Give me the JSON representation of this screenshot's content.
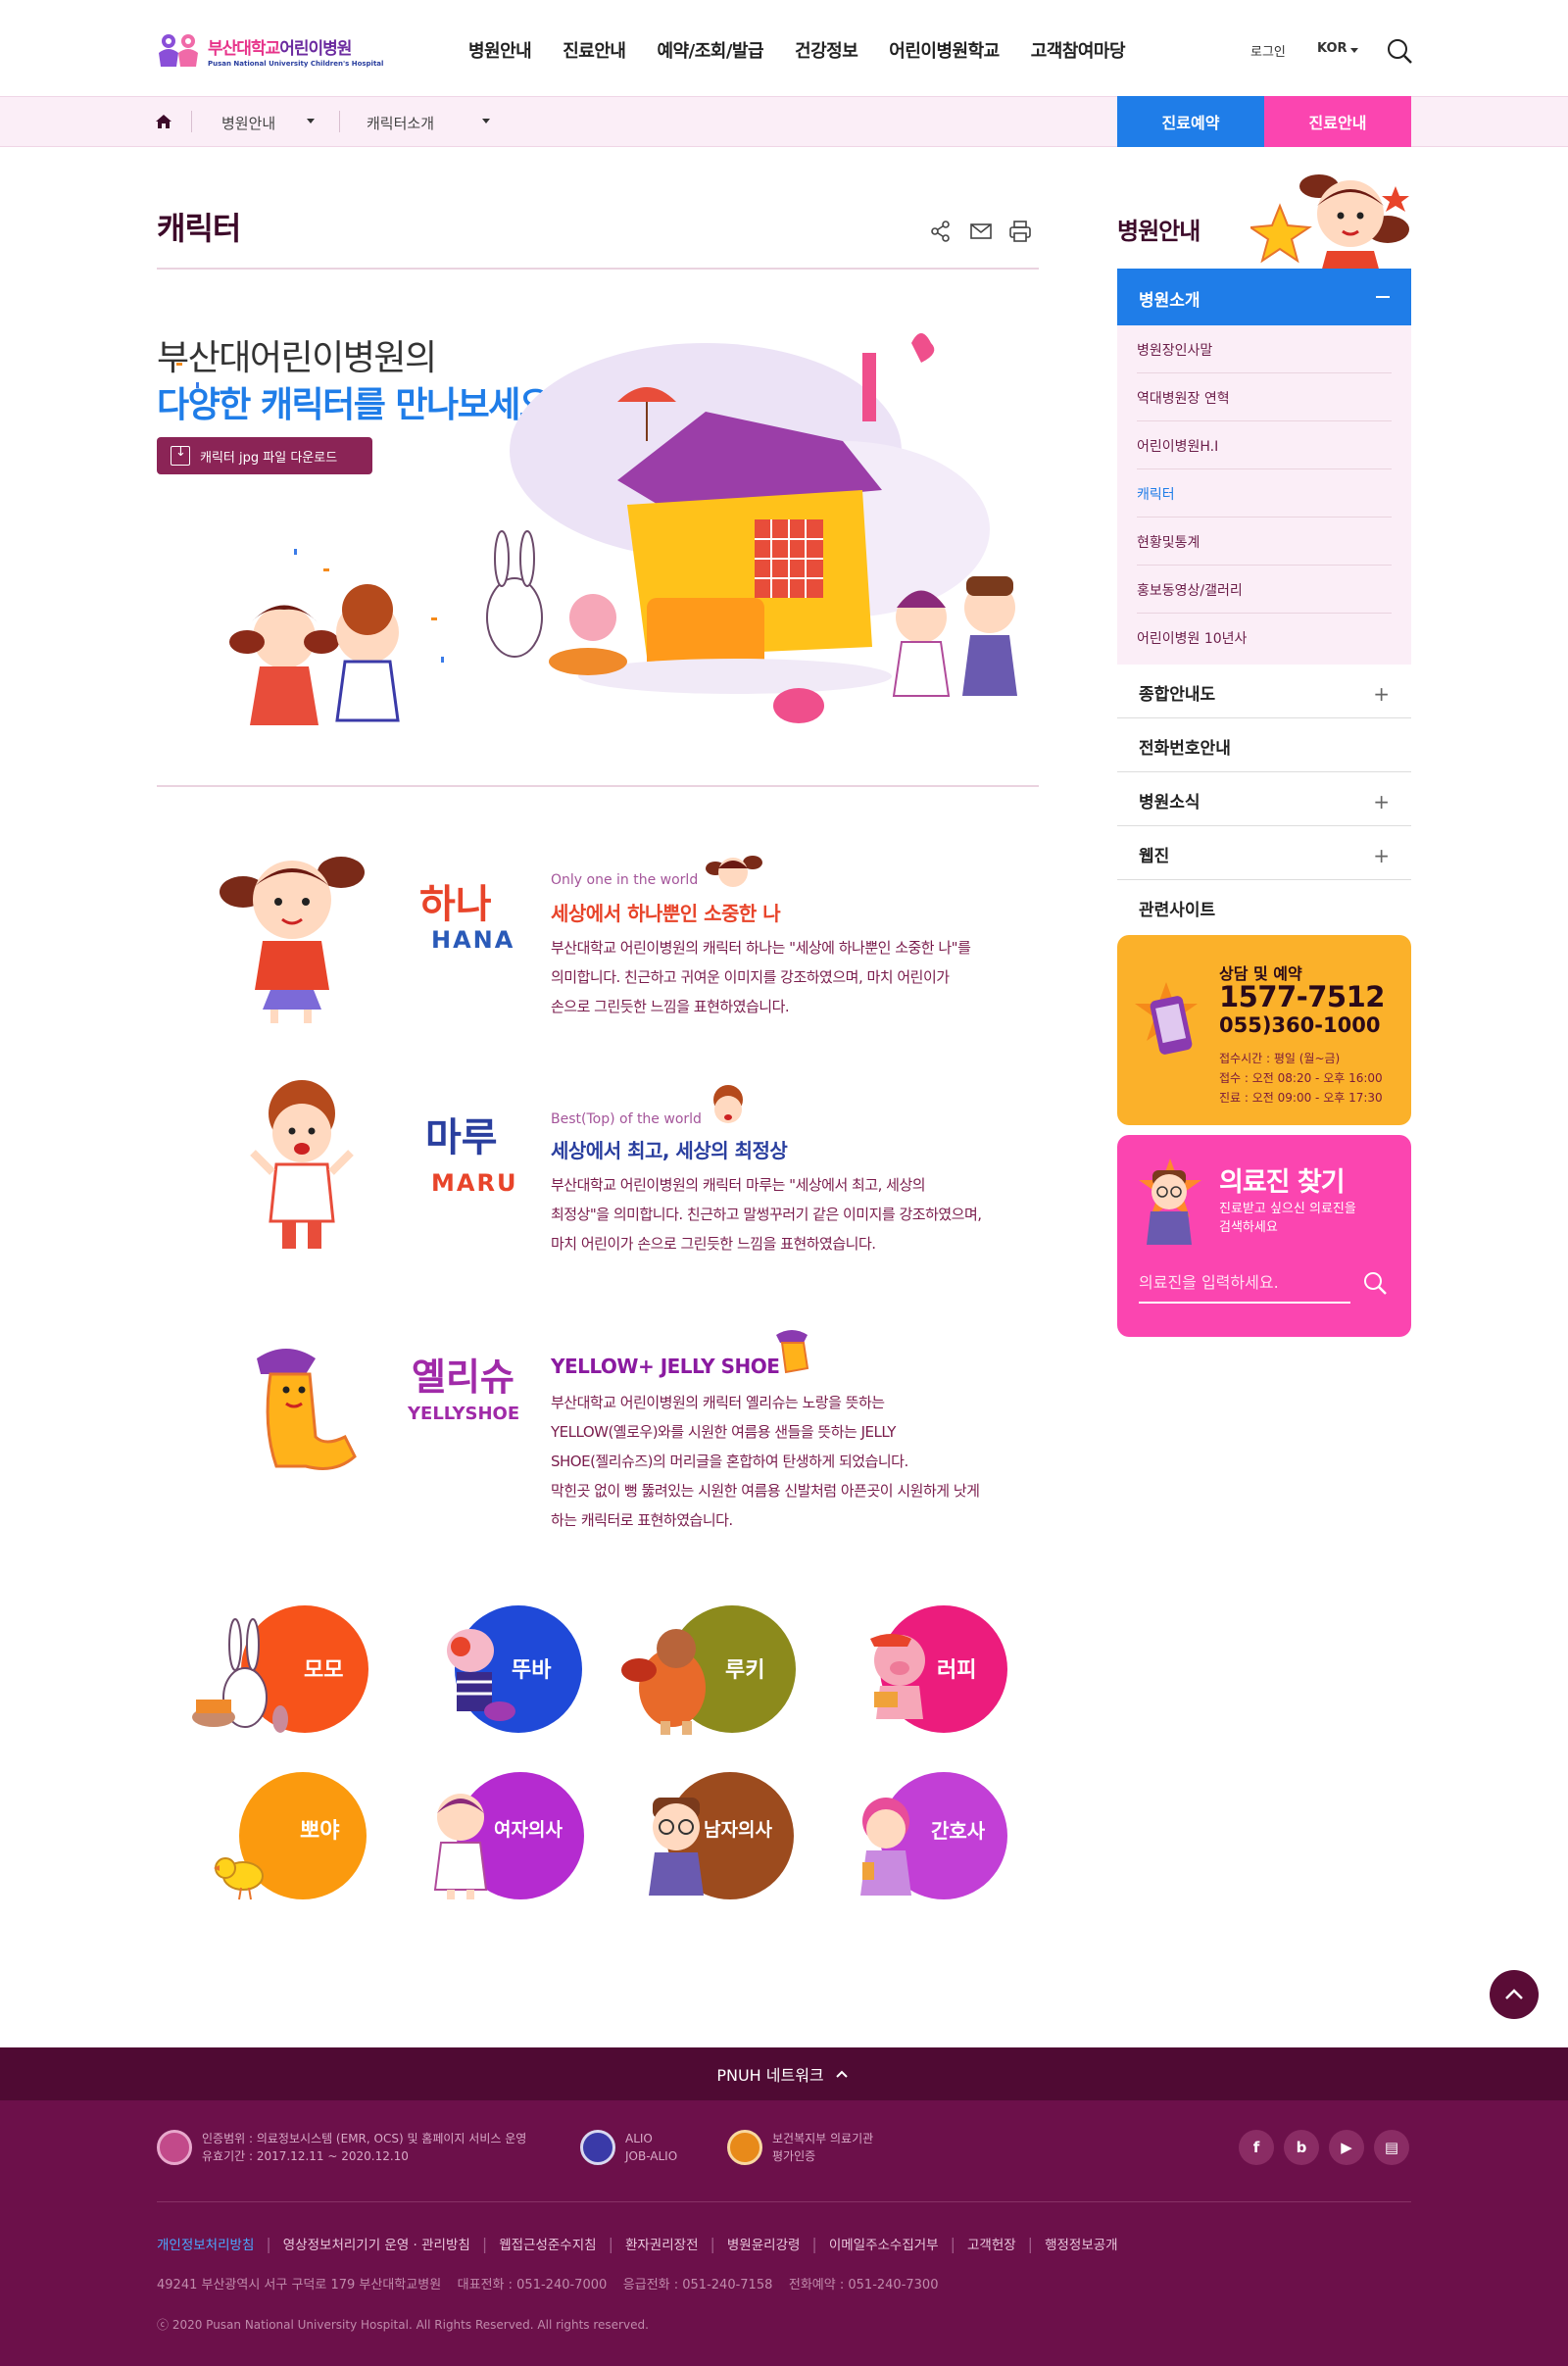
{
  "header": {
    "logo_ko_a": "부산대학교",
    "logo_ko_b": "어린이병원",
    "logo_en": "Pusan National University Children's Hospital",
    "nav": [
      "병원안내",
      "진료안내",
      "예약/조회/발급",
      "건강정보",
      "어린이병원학교",
      "고객참여마당"
    ],
    "login": "로그인",
    "lang": "KOR"
  },
  "breadcrumb": {
    "items": [
      "병원안내",
      "캐릭터소개"
    ],
    "quick": [
      "진료예약",
      "진료안내"
    ]
  },
  "main": {
    "title": "캐릭터",
    "intro_line1": "부산대어린이병원의",
    "intro_line2": "다양한 캐릭터를 만나보세요.",
    "download_label": "캐릭터 jpg 파일 다운로드",
    "characters": [
      {
        "name_ko": "하나",
        "name_en": "HANA",
        "sub": "Only one in the world",
        "head": "세상에서 하나뿐인 소중한 나",
        "body": [
          "부산대학교 어린이병원의 캐릭터 하나는 \"세상에 하나뿐인 소중한 나\"를",
          "의미합니다. 친근하고 귀여운 이미지를 강조하였으며, 마치 어린이가",
          "손으로 그린듯한 느낌을 표현하였습니다."
        ]
      },
      {
        "name_ko": "마루",
        "name_en": "MARU",
        "sub": "Best(Top) of the world",
        "head": "세상에서 최고, 세상의 최정상",
        "body": [
          "부산대학교 어린이병원의 캐릭터 마루는 \"세상에서 최고, 세상의",
          "최정상\"을 의미합니다. 친근하고 말썽꾸러기 같은 이미지를 강조하였으며,",
          "마치 어린이가 손으로 그린듯한 느낌을 표현하였습니다."
        ]
      },
      {
        "name_ko": "옐리슈",
        "name_en": "YELLYSHOE",
        "sub": "",
        "head": "YELLOW+ JELLY SHOE",
        "body": [
          "부산대학교 어린이병원의 캐릭터 옐리슈는 노랑을 뜻하는",
          "YELLOW(옐로우)와를 시원한 여름용 샌들을 뜻하는 JELLY",
          "SHOE(젤리슈즈)의 머리글을 혼합하여 탄생하게 되었습니다.",
          "막힌곳 없이 뻥 뚫려있는 시원한 여름용 신발처럼 아픈곳이 시원하게 낫게",
          "하는 캐릭터로 표현하였습니다."
        ]
      }
    ],
    "friends": [
      {
        "label": "모모",
        "color": "#f7531a"
      },
      {
        "label": "뚜바",
        "color": "#1f49d8"
      },
      {
        "label": "루키",
        "color": "#8c8a1c"
      },
      {
        "label": "러피",
        "color": "#ec1c7d"
      },
      {
        "label": "뽀야",
        "color": "#fb9a0e"
      },
      {
        "label": "여자의사",
        "color": "#b52bd0"
      },
      {
        "label": "남자의사",
        "color": "#9c4b1e"
      },
      {
        "label": "간호사",
        "color": "#c23fd6"
      }
    ]
  },
  "sidebar": {
    "title": "병원안내",
    "active": "병원소개",
    "sub_items": [
      "병원장인사말",
      "역대병원장 연혁",
      "어린이병원H.I",
      "캐릭터",
      "현황및통계",
      "홍보동영상/갤러리",
      "어린이병원 10년사"
    ],
    "menus": [
      "종합안내도",
      "전화번호안내",
      "병원소식",
      "웹진",
      "관련사이트"
    ],
    "call": {
      "title": "상담 및 예약",
      "phone1": "1577-7512",
      "phone2": "055)360-1000",
      "hours": [
        "접수시간 : 평일 (월~금)",
        "접수 : 오전 08:20 - 오후 16:00",
        "진료 : 오전 09:00 - 오후 17:30"
      ]
    },
    "doctor": {
      "title": "의료진 찾기",
      "desc1": "진료받고 싶으신 의료진을",
      "desc2": "검색하세요",
      "placeholder": "의료진을 입력하세요."
    }
  },
  "footer": {
    "network": "PNUH 네트워크",
    "cert1a": "인증범위 : 의료정보시스템 (EMR, OCS) 및 홈페이지 서비스 운영",
    "cert1b": "유효기간 : 2017.12.11 ~ 2020.12.10",
    "cert2a": "ALIO",
    "cert2b": "JOB-ALIO",
    "cert3a": "보건복지부 의료기관",
    "cert3b": "평가인증",
    "links": [
      "개인정보처리방침",
      "영상정보처리기기 운영 · 관리방침",
      "웹접근성준수지침",
      "환자권리장전",
      "병원윤리강령",
      "이메일주소수집거부",
      "고객헌장",
      "행정정보공개"
    ],
    "address": "49241 부산광역시 서구 구덕로 179 부산대학교병원    대표전화 : 051-240-7000    응급전화 : 051-240-7158    전화예약 : 051-240-7300",
    "copyright": "ⓒ 2020 Pusan National University Hospital. All Rights Reserved. All rights reserved."
  }
}
